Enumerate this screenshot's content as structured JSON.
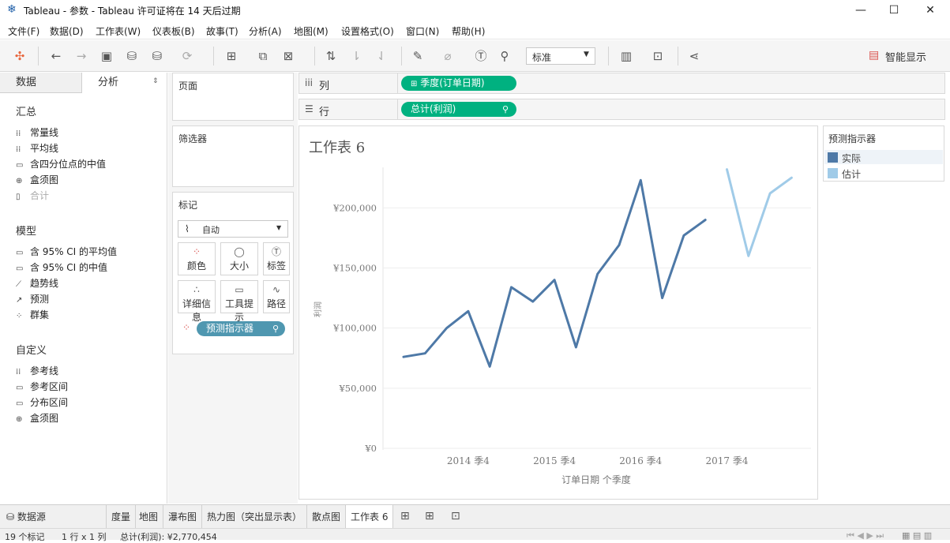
{
  "window": {
    "title": "Tableau - 参数 - Tableau 许可证将在 14 天后过期"
  },
  "menu": [
    "文件(F)",
    "数据(D)",
    "工作表(W)",
    "仪表板(B)",
    "故事(T)",
    "分析(A)",
    "地图(M)",
    "设置格式(O)",
    "窗口(N)",
    "帮助(H)"
  ],
  "toolbar": {
    "fit_value": "标准",
    "smart_show": "智能显示"
  },
  "left_pane": {
    "tabs": [
      "数据",
      "分析"
    ],
    "sections": [
      {
        "title": "汇总",
        "items": [
          {
            "label": "常量线",
            "icon": "constant-line-icon",
            "disabled": false
          },
          {
            "label": "平均线",
            "icon": "average-line-icon",
            "disabled": false
          },
          {
            "label": "含四分位点的中值",
            "icon": "median-quartiles-icon",
            "disabled": false
          },
          {
            "label": "盒须图",
            "icon": "box-plot-icon",
            "disabled": false
          },
          {
            "label": "合计",
            "icon": "totals-icon",
            "disabled": true
          }
        ]
      },
      {
        "title": "模型",
        "items": [
          {
            "label": "含 95% CI 的平均值",
            "icon": "average-ci-icon",
            "disabled": false
          },
          {
            "label": "含 95% CI 的中值",
            "icon": "median-ci-icon",
            "disabled": false
          },
          {
            "label": "趋势线",
            "icon": "trend-line-icon",
            "disabled": false
          },
          {
            "label": "预测",
            "icon": "forecast-icon",
            "disabled": false
          },
          {
            "label": "群集",
            "icon": "cluster-icon",
            "disabled": false
          }
        ]
      },
      {
        "title": "自定义",
        "items": [
          {
            "label": "参考线",
            "icon": "reference-line-icon",
            "disabled": false
          },
          {
            "label": "参考区间",
            "icon": "reference-band-icon",
            "disabled": false
          },
          {
            "label": "分布区间",
            "icon": "distribution-band-icon",
            "disabled": false
          },
          {
            "label": "盒须图",
            "icon": "box-plot-icon",
            "disabled": false
          }
        ]
      }
    ]
  },
  "cards": {
    "pages": "页面",
    "filters": "筛选器",
    "marks": {
      "title": "标记",
      "type": "自动",
      "buttons": [
        "颜色",
        "大小",
        "标签",
        "详细信息",
        "工具提示",
        "路径"
      ],
      "pill": "预测指示器"
    }
  },
  "shelves": {
    "columns": {
      "label": "列",
      "pill": "季度(订单日期)"
    },
    "rows": {
      "label": "行",
      "pill": "总计(利润)"
    }
  },
  "legend": {
    "title": "预测指示器",
    "items": [
      {
        "label": "实际",
        "color": "#4e79a7"
      },
      {
        "label": "估计",
        "color": "#a0cbe8"
      }
    ]
  },
  "chart_data": {
    "type": "line",
    "title": "工作表 6",
    "xlabel": "订单日期 个季度",
    "ylabel": "利润",
    "x_ticks": [
      "2014 季4",
      "2015 季4",
      "2016 季4",
      "2017 季4"
    ],
    "y_ticks": [
      "¥0",
      "¥50,000",
      "¥100,000",
      "¥150,000",
      "¥200,000"
    ],
    "ylim": [
      0,
      235000
    ],
    "categories": [
      "2014 季1",
      "2014 季2",
      "2014 季3",
      "2014 季4",
      "2015 季1",
      "2015 季2",
      "2015 季3",
      "2015 季4",
      "2016 季1",
      "2016 季2",
      "2016 季3",
      "2016 季4",
      "2017 季1",
      "2017 季2",
      "2017 季3",
      "2017 季4",
      "2018 季1",
      "2018 季2",
      "2018 季3"
    ],
    "series": [
      {
        "name": "实际",
        "color": "#4e79a7",
        "values": [
          76000,
          79000,
          100000,
          114000,
          68000,
          134000,
          122000,
          140000,
          84000,
          145000,
          169000,
          223000,
          125000,
          177000,
          190000,
          null,
          null,
          null,
          null
        ]
      },
      {
        "name": "估计",
        "color": "#a0cbe8",
        "values": [
          null,
          null,
          null,
          null,
          null,
          null,
          null,
          null,
          null,
          null,
          null,
          null,
          null,
          null,
          null,
          232000,
          160000,
          212000,
          225000
        ]
      }
    ],
    "grid": true
  },
  "sheet_tabs": [
    "数据源",
    "度量",
    "地图",
    "瀑布图",
    "热力图（突出显示表）",
    "散点图",
    "工作表 6"
  ],
  "status": {
    "marks": "19 个标记",
    "grid": "1 行 x 1 列",
    "sum": "总计(利润): ¥2,770,454"
  }
}
